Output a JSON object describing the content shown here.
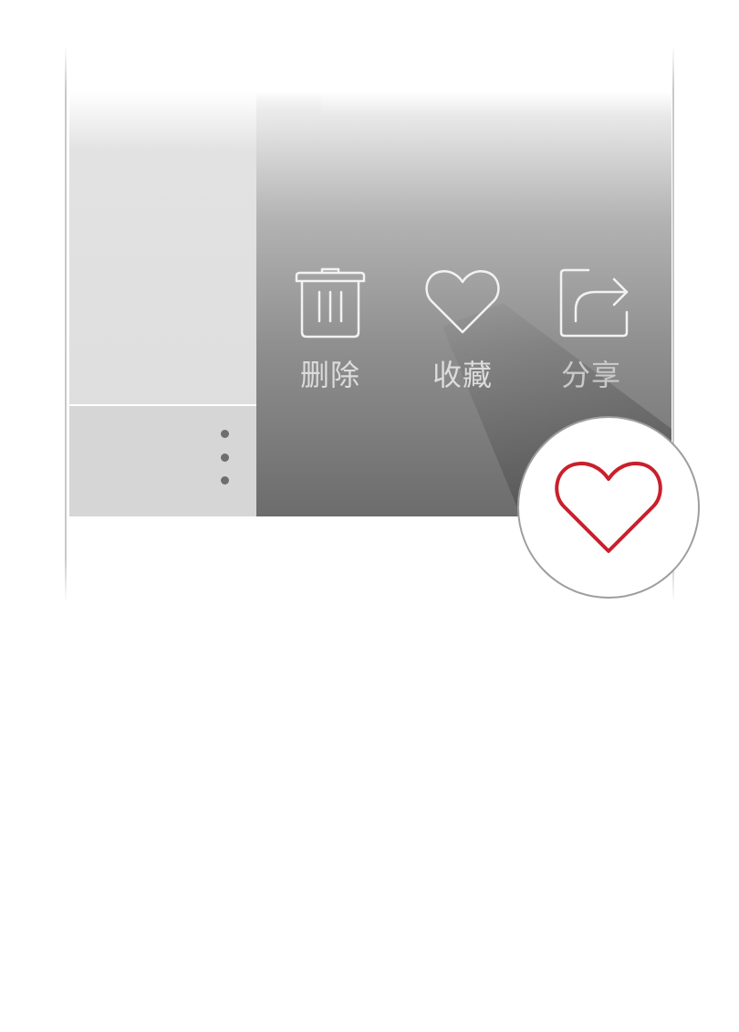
{
  "actions": {
    "delete": {
      "label": "删除",
      "icon": "trash-icon"
    },
    "favorite": {
      "label": "收藏",
      "icon": "heart-icon"
    },
    "share": {
      "label": "分享",
      "icon": "share-icon"
    }
  },
  "more_menu": {
    "icon": "more-vertical-icon"
  },
  "zoom_callout": {
    "icon": "heart-icon",
    "color": "#c8202c"
  },
  "colors": {
    "icon_outline": "#f2f2f2",
    "label": "#dcdcdc",
    "accent_heart": "#c8202c",
    "dots": "#6e6e6e"
  }
}
